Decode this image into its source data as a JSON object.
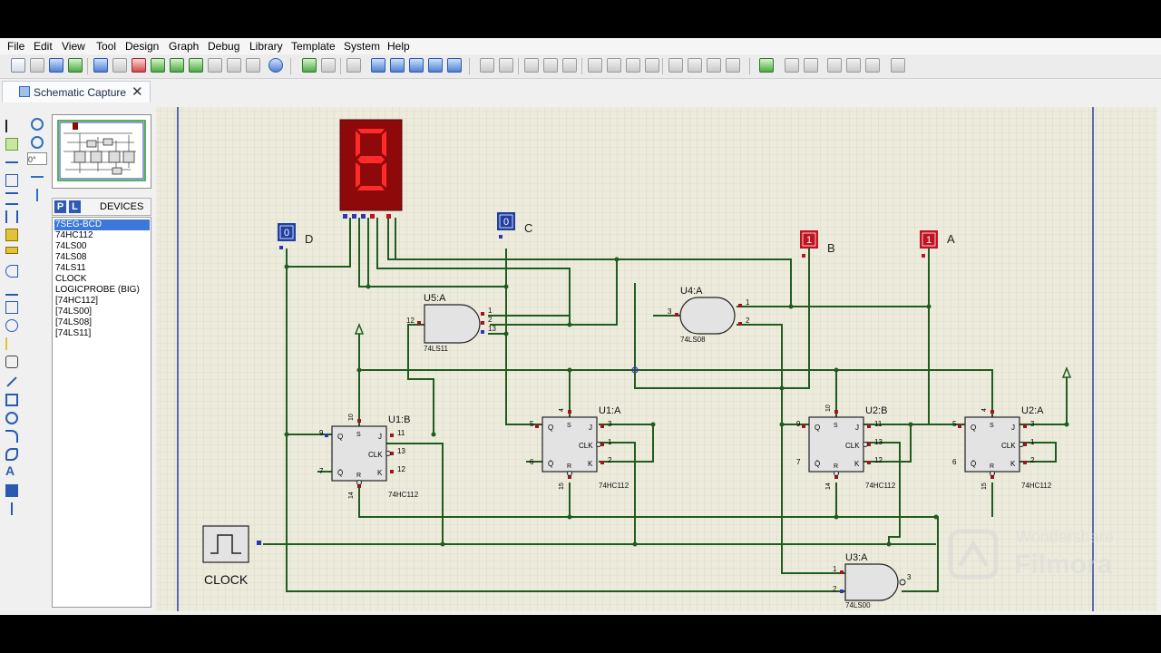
{
  "menu": [
    "File",
    "Edit",
    "View",
    "Tool",
    "Design",
    "Graph",
    "Debug",
    "Library",
    "Template",
    "System",
    "Help"
  ],
  "tab": {
    "title": "Schematic Capture",
    "close": "✕"
  },
  "rotation_field": {
    "value": "0°"
  },
  "devices": {
    "p_button": "P",
    "l_button": "L",
    "title": "DEVICES",
    "items": [
      "7SEG-BCD",
      "74HC112",
      "74LS00",
      "74LS08",
      "74LS11",
      "CLOCK",
      "LOGICPROBE (BIG)",
      "[74HC112]",
      "[74LS00]",
      "[74LS08]",
      "[74LS11]"
    ],
    "selected_index": 0
  },
  "schematic": {
    "display_digit": "8",
    "inputs": [
      {
        "label": "D",
        "state": "0"
      },
      {
        "label": "C",
        "state": "0"
      },
      {
        "label": "B",
        "state": "1"
      },
      {
        "label": "A",
        "state": "1"
      }
    ],
    "gates": {
      "u5a": {
        "ref": "U5:A",
        "part": "74LS11",
        "pins": [
          "12",
          "1",
          "2",
          "13"
        ]
      },
      "u4a": {
        "ref": "U4:A",
        "part": "74LS08",
        "pins": [
          "3",
          "1",
          "2"
        ]
      },
      "u3a": {
        "ref": "U3:A",
        "part": "74LS00",
        "pins": [
          "1",
          "2",
          "3"
        ]
      }
    },
    "flipflops": [
      {
        "ref": "U1:B",
        "part": "74HC112",
        "pins": [
          "10",
          "9",
          "7",
          "11",
          "13",
          "12",
          "14"
        ]
      },
      {
        "ref": "U1:A",
        "part": "74HC112",
        "pins": [
          "4",
          "5",
          "6",
          "3",
          "1",
          "2",
          "15"
        ]
      },
      {
        "ref": "U2:B",
        "part": "74HC112",
        "pins": [
          "10",
          "9",
          "7",
          "11",
          "13",
          "12",
          "14"
        ]
      },
      {
        "ref": "U2:A",
        "part": "74HC112",
        "pins": [
          "4",
          "5",
          "6",
          "3",
          "1",
          "2",
          "15"
        ]
      }
    ],
    "ff_letters": {
      "q": "Q",
      "qb": "Q̄",
      "s": "S",
      "r": "R",
      "j": "J",
      "k": "K",
      "clk": "CLK"
    },
    "clock": {
      "label": "CLOCK"
    }
  },
  "watermark": {
    "line1": "Wondershare",
    "line2": "Filmora"
  },
  "colors": {
    "wire": "#1f5c1f",
    "chip_fill": "#e3e3e3",
    "pin_red": "#a0141e",
    "pin_blue": "#2d36b8",
    "probe_low": "#1f3fa3",
    "probe_high": "#c1121f",
    "grid_bg": "#ecebdc",
    "segment_on": "#ff2a2a",
    "display_bg": "#8e0a0a"
  }
}
